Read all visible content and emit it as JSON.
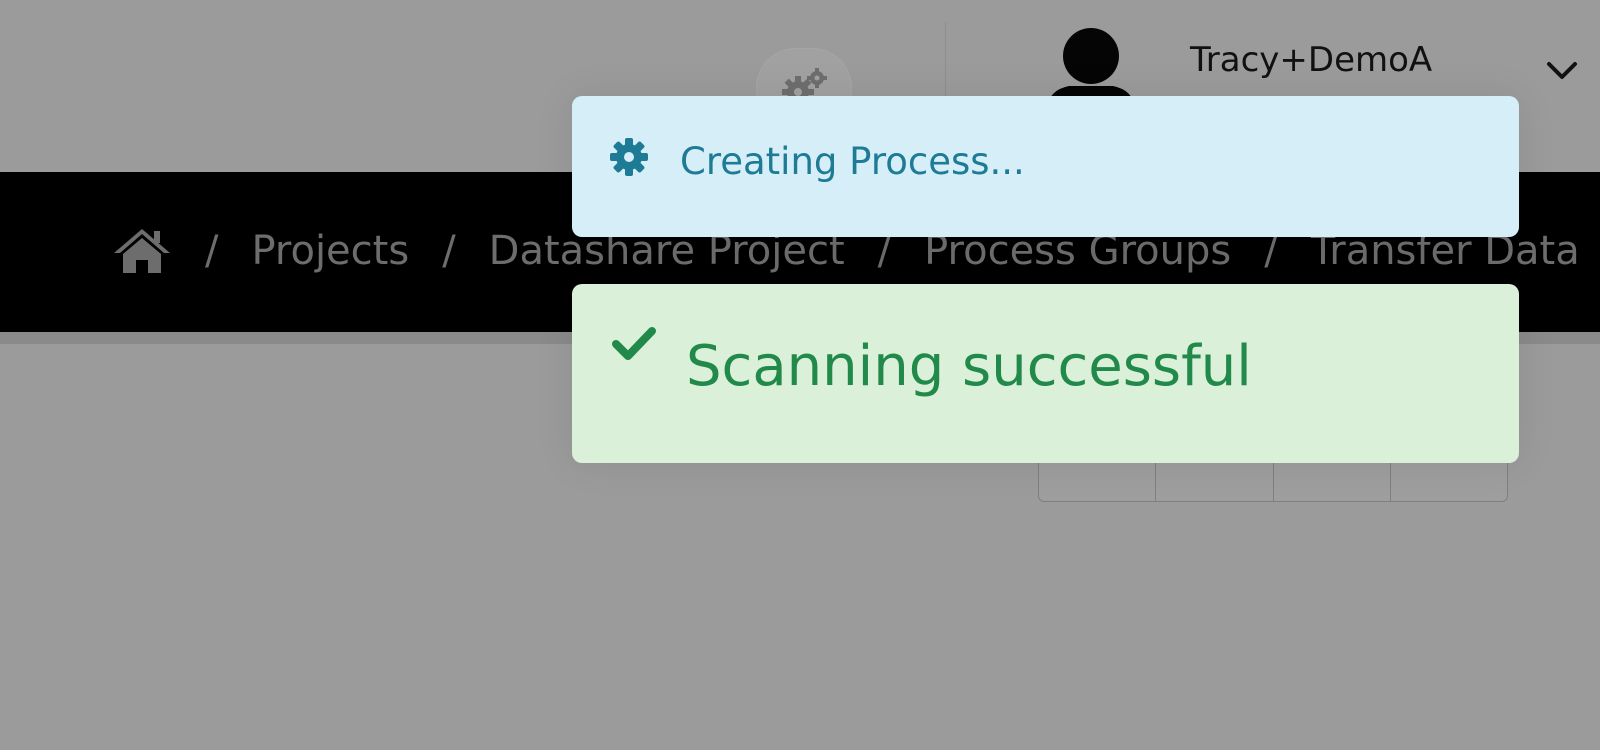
{
  "header": {
    "user_name": "Tracy+DemoA",
    "settings_icon": "gears-icon",
    "avatar_icon": "user-silhouette-icon",
    "dropdown_icon": "chevron-down-icon"
  },
  "breadcrumb": {
    "home_icon": "home-icon",
    "separator": "/",
    "items": [
      "Projects",
      "Datashare Project",
      "Process Groups",
      "Transfer Data"
    ]
  },
  "alerts": {
    "info": {
      "icon": "gear-icon",
      "message": "Creating Process...",
      "color": "#1e7b96",
      "background": "#d5eef7"
    },
    "success": {
      "icon": "checkmark-icon",
      "message": "Scanning successful",
      "color": "#21894a",
      "background": "#daf0d8"
    }
  },
  "colors": {
    "overlay": "#9b9b9b",
    "breadcrumb_bar": "#000000"
  }
}
